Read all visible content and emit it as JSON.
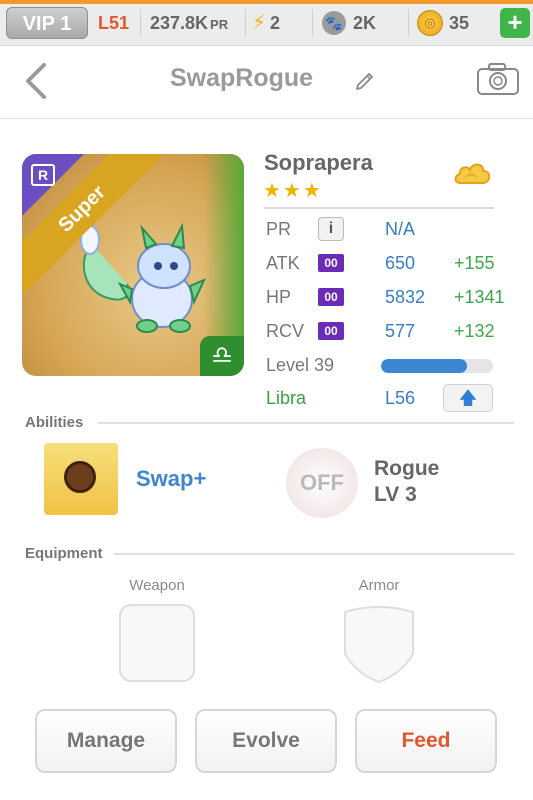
{
  "topbar": {
    "vip": "VIP 1",
    "level": "L51",
    "pr_value": "237.8K",
    "pr_unit": "PR",
    "energy": "2",
    "paws": "2K",
    "coins": "35",
    "add_symbol": "+",
    "icons": [
      "bolt-icon",
      "paw-icon",
      "coin-icon",
      "plus-icon"
    ]
  },
  "header": {
    "title": "SwapRogue",
    "icons": [
      "back-icon",
      "pencil-icon",
      "camera-icon"
    ]
  },
  "card": {
    "rarity_letter": "R",
    "banner": "Super",
    "zodiac_symbol": "♎"
  },
  "monster": {
    "name": "Soprapera",
    "stars": "★★★",
    "pr": {
      "label": "PR",
      "info": "i",
      "value": "N/A"
    },
    "atk": {
      "label": "ATK",
      "badge": "00",
      "value": "650",
      "bonus": "+155"
    },
    "hp": {
      "label": "HP",
      "badge": "00",
      "value": "5832",
      "bonus": "+1341"
    },
    "rcv": {
      "label": "RCV",
      "badge": "00",
      "value": "577",
      "bonus": "+132"
    },
    "level": {
      "label": "Level 39",
      "progress": 0.77
    },
    "zodiac": {
      "label": "Libra",
      "value": "L56",
      "upgrade_symbol": "🡅"
    }
  },
  "abilities": {
    "title": "Abilities",
    "ability1": "Swap+",
    "ability2_state": "OFF",
    "ability2_name": "Rogue",
    "ability2_level": "LV 3"
  },
  "equipment": {
    "title": "Equipment",
    "weapon_label": "Weapon",
    "armor_label": "Armor"
  },
  "actions": {
    "manage": "Manage",
    "evolve": "Evolve",
    "feed": "Feed"
  }
}
